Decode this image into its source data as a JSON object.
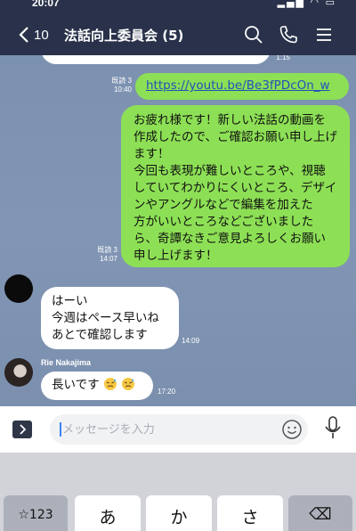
{
  "status_bar": {
    "time": "20:07",
    "icons": "▂▄▆ ◠ ▭"
  },
  "header": {
    "back_count": "10",
    "title": "法話向上委員会 (5)"
  },
  "messages": [
    {
      "type": "outgoing",
      "text": "...",
      "time": "1:15"
    },
    {
      "type": "outgoing",
      "read": "既読 3",
      "time": "10:40",
      "link": "https://youtu.be/Be3fPDcOn_w"
    },
    {
      "type": "outgoing",
      "read": "既読 3",
      "time": "14:07",
      "lines": [
        "お疲れ様です！新しい法話の動画を",
        "作成したので、ご確認お願い申し上げ",
        "ます！",
        "今回も表現が難しいところや、視聴",
        "していてわかりにくいところ、デザイ",
        "ンやアングルなどで編集を加えた",
        "方がいいところなどございました",
        "ら、奇譚なきご意見よろしくお願い",
        "申し上げます！"
      ]
    },
    {
      "type": "incoming",
      "time": "14:09",
      "lines": [
        "はーい",
        "今週はペース早いね",
        "あとで確認します"
      ]
    },
    {
      "type": "incoming",
      "sender": "Rie Nakajima",
      "time": "17:20",
      "text": "長いです"
    }
  ],
  "input": {
    "placeholder": "メッセージを入力"
  },
  "keyboard": {
    "keys": [
      {
        "label": "☆123"
      },
      {
        "label": "あ"
      },
      {
        "label": "か"
      },
      {
        "label": "さ"
      },
      {
        "label": "⌫"
      }
    ]
  },
  "colors": {
    "header_bg": "#29324a",
    "chat_bg": "#7f93b1",
    "outgoing_bubble": "#8de055",
    "incoming_bubble": "#ffffff",
    "link": "#1f52b8"
  },
  "icons": [
    "back-chevron-icon",
    "search-icon",
    "phone-icon",
    "menu-icon",
    "plus-icon",
    "smiley-icon",
    "mic-icon",
    "sweat-emoji-icon"
  ]
}
